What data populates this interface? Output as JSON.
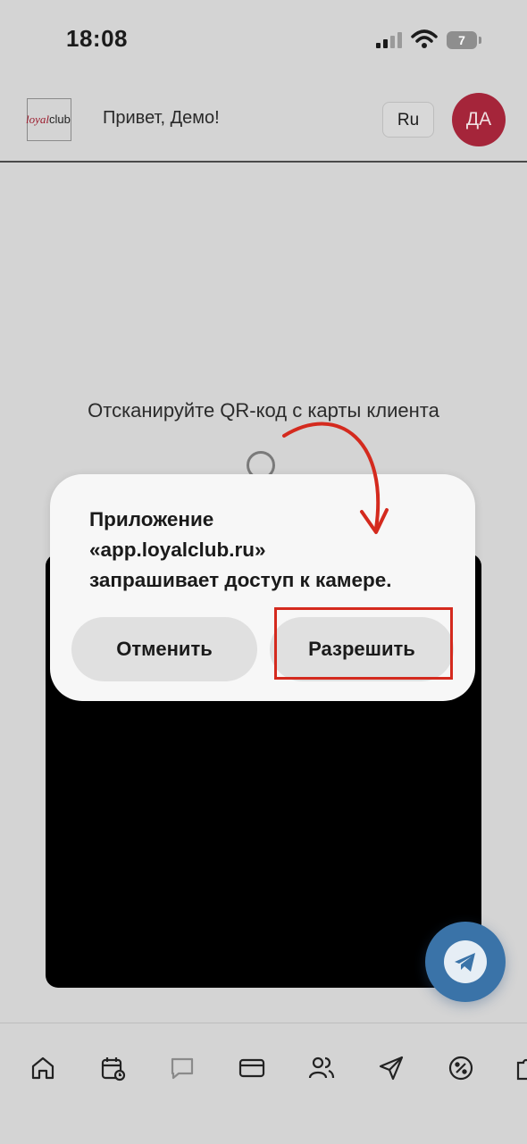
{
  "status_bar": {
    "time": "18:08",
    "battery": "7"
  },
  "header": {
    "logo_loyal": "loyal",
    "logo_club": "club",
    "greeting": "Привет, Демо!",
    "language": "Ru",
    "avatar_initials": "ДА"
  },
  "main": {
    "scan_prompt": "Отсканируйте QR-код с карты клиента"
  },
  "dialog": {
    "message_lines": [
      "Приложение",
      "«app.loyalclub.ru»",
      "запрашивает доступ к камере."
    ],
    "cancel_label": "Отменить",
    "allow_label": "Разрешить"
  },
  "colors": {
    "background": "#d4d4d4",
    "brand": "#9b1c2e",
    "avatar": "#a5253a",
    "annotation": "#d42a1e",
    "telegram": "#3a73a8"
  },
  "bottom_nav": {
    "icons": [
      "home-icon",
      "calendar-icon",
      "chat-icon",
      "card-icon",
      "users-icon",
      "send-icon",
      "discount-icon",
      "puzzle-icon"
    ]
  }
}
